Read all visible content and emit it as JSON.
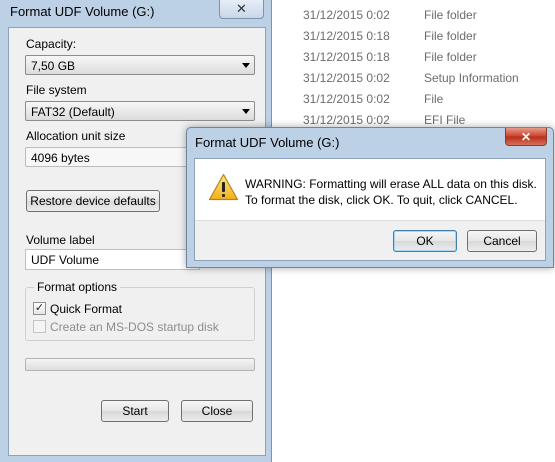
{
  "background_list": {
    "rows": [
      {
        "date": "31/12/2015 0:02",
        "type": "File folder"
      },
      {
        "date": "31/12/2015 0:18",
        "type": "File folder"
      },
      {
        "date": "31/12/2015 0:18",
        "type": "File folder"
      },
      {
        "date": "31/12/2015 0:02",
        "type": "Setup Information"
      },
      {
        "date": "31/12/2015 0:02",
        "type": "File"
      },
      {
        "date": "31/12/2015 0:02",
        "type": "EFI File"
      }
    ]
  },
  "format_dialog": {
    "title": "Format UDF Volume (G:)",
    "close_label": "✕",
    "capacity_label": "Capacity:",
    "capacity_value": "7,50 GB",
    "filesystem_label": "File system",
    "filesystem_value": "FAT32 (Default)",
    "allocation_label": "Allocation unit size",
    "allocation_value": "4096 bytes",
    "restore_label": "Restore device defaults",
    "volume_label_label": "Volume label",
    "volume_label_value": "UDF Volume",
    "format_options_label": "Format options",
    "quick_format_label": "Quick Format",
    "quick_format_checked": true,
    "msdos_label": "Create an MS-DOS startup disk",
    "msdos_checked": false,
    "progress": 0,
    "start_label": "Start",
    "close_button_label": "Close"
  },
  "warning_dialog": {
    "title": "Format UDF Volume (G:)",
    "close_label": "✕",
    "icon": "warning-icon",
    "message_line1": "WARNING: Formatting will erase ALL data on this disk.",
    "message_line2": "To format the disk, click OK. To quit, click CANCEL.",
    "ok_label": "OK",
    "cancel_label": "Cancel"
  },
  "colors": {
    "window_frame": "#bcd0e6",
    "warning_close": "#c8412c",
    "default_button_border": "#3c7fb1"
  }
}
